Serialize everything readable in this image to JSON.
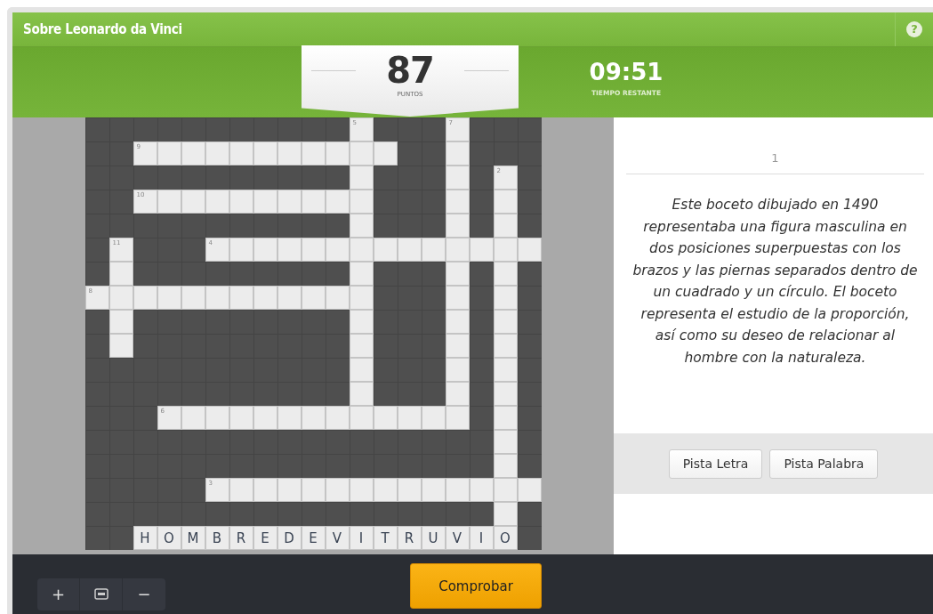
{
  "title": "Sobre Leonardo da Vinci",
  "help": "?",
  "score": {
    "value": "87",
    "label": "PUNTOS"
  },
  "timer": {
    "value": "09:51",
    "label": "TIEMPO RESTANTE"
  },
  "grid": [
    [
      {
        "kind": "block"
      },
      {
        "kind": "block"
      },
      {
        "kind": "block"
      },
      {
        "kind": "block"
      },
      {
        "kind": "block"
      },
      {
        "kind": "block"
      },
      {
        "kind": "block"
      },
      {
        "kind": "block"
      },
      {
        "kind": "block"
      },
      {
        "kind": "block"
      },
      {
        "kind": "block"
      },
      {
        "kind": "empty",
        "number": "5"
      },
      {
        "kind": "block"
      },
      {
        "kind": "block"
      },
      {
        "kind": "block"
      },
      {
        "kind": "empty",
        "number": "7"
      },
      {
        "kind": "block"
      },
      {
        "kind": "block"
      },
      {
        "kind": "block"
      }
    ],
    [
      {
        "kind": "block"
      },
      {
        "kind": "block"
      },
      {
        "kind": "empty",
        "number": "9"
      },
      {
        "kind": "empty"
      },
      {
        "kind": "empty"
      },
      {
        "kind": "empty"
      },
      {
        "kind": "empty"
      },
      {
        "kind": "empty"
      },
      {
        "kind": "empty"
      },
      {
        "kind": "empty"
      },
      {
        "kind": "empty"
      },
      {
        "kind": "empty"
      },
      {
        "kind": "empty"
      },
      {
        "kind": "block"
      },
      {
        "kind": "block"
      },
      {
        "kind": "empty"
      },
      {
        "kind": "block"
      },
      {
        "kind": "block"
      },
      {
        "kind": "block"
      }
    ],
    [
      {
        "kind": "block"
      },
      {
        "kind": "block"
      },
      {
        "kind": "block"
      },
      {
        "kind": "block"
      },
      {
        "kind": "block"
      },
      {
        "kind": "block"
      },
      {
        "kind": "block"
      },
      {
        "kind": "block"
      },
      {
        "kind": "block"
      },
      {
        "kind": "block"
      },
      {
        "kind": "block"
      },
      {
        "kind": "empty"
      },
      {
        "kind": "block"
      },
      {
        "kind": "block"
      },
      {
        "kind": "block"
      },
      {
        "kind": "empty"
      },
      {
        "kind": "block"
      },
      {
        "kind": "empty",
        "number": "2"
      },
      {
        "kind": "block"
      }
    ],
    [
      {
        "kind": "block"
      },
      {
        "kind": "block"
      },
      {
        "kind": "empty",
        "number": "10"
      },
      {
        "kind": "empty"
      },
      {
        "kind": "empty"
      },
      {
        "kind": "empty"
      },
      {
        "kind": "empty"
      },
      {
        "kind": "empty"
      },
      {
        "kind": "empty"
      },
      {
        "kind": "empty"
      },
      {
        "kind": "empty"
      },
      {
        "kind": "empty"
      },
      {
        "kind": "block"
      },
      {
        "kind": "block"
      },
      {
        "kind": "block"
      },
      {
        "kind": "empty"
      },
      {
        "kind": "block"
      },
      {
        "kind": "empty"
      },
      {
        "kind": "block"
      }
    ],
    [
      {
        "kind": "block"
      },
      {
        "kind": "block"
      },
      {
        "kind": "block"
      },
      {
        "kind": "block"
      },
      {
        "kind": "block"
      },
      {
        "kind": "block"
      },
      {
        "kind": "block"
      },
      {
        "kind": "block"
      },
      {
        "kind": "block"
      },
      {
        "kind": "block"
      },
      {
        "kind": "block"
      },
      {
        "kind": "empty"
      },
      {
        "kind": "block"
      },
      {
        "kind": "block"
      },
      {
        "kind": "block"
      },
      {
        "kind": "empty"
      },
      {
        "kind": "block"
      },
      {
        "kind": "empty"
      },
      {
        "kind": "block"
      }
    ],
    [
      {
        "kind": "block"
      },
      {
        "kind": "empty",
        "number": "11"
      },
      {
        "kind": "block"
      },
      {
        "kind": "block"
      },
      {
        "kind": "block"
      },
      {
        "kind": "empty",
        "number": "4"
      },
      {
        "kind": "empty"
      },
      {
        "kind": "empty"
      },
      {
        "kind": "empty"
      },
      {
        "kind": "empty"
      },
      {
        "kind": "empty"
      },
      {
        "kind": "empty"
      },
      {
        "kind": "empty"
      },
      {
        "kind": "empty"
      },
      {
        "kind": "empty"
      },
      {
        "kind": "empty"
      },
      {
        "kind": "empty"
      },
      {
        "kind": "empty"
      },
      {
        "kind": "empty"
      }
    ],
    [
      {
        "kind": "block"
      },
      {
        "kind": "empty"
      },
      {
        "kind": "block"
      },
      {
        "kind": "block"
      },
      {
        "kind": "block"
      },
      {
        "kind": "block"
      },
      {
        "kind": "block"
      },
      {
        "kind": "block"
      },
      {
        "kind": "block"
      },
      {
        "kind": "block"
      },
      {
        "kind": "block"
      },
      {
        "kind": "empty"
      },
      {
        "kind": "block"
      },
      {
        "kind": "block"
      },
      {
        "kind": "block"
      },
      {
        "kind": "empty"
      },
      {
        "kind": "block"
      },
      {
        "kind": "empty"
      },
      {
        "kind": "block"
      }
    ],
    [
      {
        "kind": "empty",
        "number": "8"
      },
      {
        "kind": "empty"
      },
      {
        "kind": "empty"
      },
      {
        "kind": "empty"
      },
      {
        "kind": "empty"
      },
      {
        "kind": "empty"
      },
      {
        "kind": "empty"
      },
      {
        "kind": "empty"
      },
      {
        "kind": "empty"
      },
      {
        "kind": "empty"
      },
      {
        "kind": "empty"
      },
      {
        "kind": "empty"
      },
      {
        "kind": "block"
      },
      {
        "kind": "block"
      },
      {
        "kind": "block"
      },
      {
        "kind": "empty"
      },
      {
        "kind": "block"
      },
      {
        "kind": "empty"
      },
      {
        "kind": "block"
      }
    ],
    [
      {
        "kind": "block"
      },
      {
        "kind": "empty"
      },
      {
        "kind": "block"
      },
      {
        "kind": "block"
      },
      {
        "kind": "block"
      },
      {
        "kind": "block"
      },
      {
        "kind": "block"
      },
      {
        "kind": "block"
      },
      {
        "kind": "block"
      },
      {
        "kind": "block"
      },
      {
        "kind": "block"
      },
      {
        "kind": "empty"
      },
      {
        "kind": "block"
      },
      {
        "kind": "block"
      },
      {
        "kind": "block"
      },
      {
        "kind": "empty"
      },
      {
        "kind": "block"
      },
      {
        "kind": "empty"
      },
      {
        "kind": "block"
      }
    ],
    [
      {
        "kind": "block"
      },
      {
        "kind": "empty"
      },
      {
        "kind": "block"
      },
      {
        "kind": "block"
      },
      {
        "kind": "block"
      },
      {
        "kind": "block"
      },
      {
        "kind": "block"
      },
      {
        "kind": "block"
      },
      {
        "kind": "block"
      },
      {
        "kind": "block"
      },
      {
        "kind": "block"
      },
      {
        "kind": "empty"
      },
      {
        "kind": "block"
      },
      {
        "kind": "block"
      },
      {
        "kind": "block"
      },
      {
        "kind": "empty"
      },
      {
        "kind": "block"
      },
      {
        "kind": "empty"
      },
      {
        "kind": "block"
      }
    ],
    [
      {
        "kind": "block"
      },
      {
        "kind": "block"
      },
      {
        "kind": "block"
      },
      {
        "kind": "block"
      },
      {
        "kind": "block"
      },
      {
        "kind": "block"
      },
      {
        "kind": "block"
      },
      {
        "kind": "block"
      },
      {
        "kind": "block"
      },
      {
        "kind": "block"
      },
      {
        "kind": "block"
      },
      {
        "kind": "empty"
      },
      {
        "kind": "block"
      },
      {
        "kind": "block"
      },
      {
        "kind": "block"
      },
      {
        "kind": "empty"
      },
      {
        "kind": "block"
      },
      {
        "kind": "empty"
      },
      {
        "kind": "block"
      }
    ],
    [
      {
        "kind": "block"
      },
      {
        "kind": "block"
      },
      {
        "kind": "block"
      },
      {
        "kind": "block"
      },
      {
        "kind": "block"
      },
      {
        "kind": "block"
      },
      {
        "kind": "block"
      },
      {
        "kind": "block"
      },
      {
        "kind": "block"
      },
      {
        "kind": "block"
      },
      {
        "kind": "block"
      },
      {
        "kind": "empty"
      },
      {
        "kind": "block"
      },
      {
        "kind": "block"
      },
      {
        "kind": "block"
      },
      {
        "kind": "empty"
      },
      {
        "kind": "block"
      },
      {
        "kind": "empty"
      },
      {
        "kind": "block"
      }
    ],
    [
      {
        "kind": "block"
      },
      {
        "kind": "block"
      },
      {
        "kind": "block"
      },
      {
        "kind": "empty",
        "number": "6"
      },
      {
        "kind": "empty"
      },
      {
        "kind": "empty"
      },
      {
        "kind": "empty"
      },
      {
        "kind": "empty"
      },
      {
        "kind": "empty"
      },
      {
        "kind": "empty"
      },
      {
        "kind": "empty"
      },
      {
        "kind": "empty"
      },
      {
        "kind": "empty"
      },
      {
        "kind": "empty"
      },
      {
        "kind": "empty"
      },
      {
        "kind": "empty"
      },
      {
        "kind": "block"
      },
      {
        "kind": "empty"
      },
      {
        "kind": "block"
      }
    ],
    [
      {
        "kind": "block"
      },
      {
        "kind": "block"
      },
      {
        "kind": "block"
      },
      {
        "kind": "block"
      },
      {
        "kind": "block"
      },
      {
        "kind": "block"
      },
      {
        "kind": "block"
      },
      {
        "kind": "block"
      },
      {
        "kind": "block"
      },
      {
        "kind": "block"
      },
      {
        "kind": "block"
      },
      {
        "kind": "block"
      },
      {
        "kind": "block"
      },
      {
        "kind": "block"
      },
      {
        "kind": "block"
      },
      {
        "kind": "block"
      },
      {
        "kind": "block"
      },
      {
        "kind": "empty"
      },
      {
        "kind": "block"
      }
    ],
    [
      {
        "kind": "block"
      },
      {
        "kind": "block"
      },
      {
        "kind": "block"
      },
      {
        "kind": "block"
      },
      {
        "kind": "block"
      },
      {
        "kind": "block"
      },
      {
        "kind": "block"
      },
      {
        "kind": "block"
      },
      {
        "kind": "block"
      },
      {
        "kind": "block"
      },
      {
        "kind": "block"
      },
      {
        "kind": "block"
      },
      {
        "kind": "block"
      },
      {
        "kind": "block"
      },
      {
        "kind": "block"
      },
      {
        "kind": "block"
      },
      {
        "kind": "block"
      },
      {
        "kind": "empty"
      },
      {
        "kind": "block"
      }
    ],
    [
      {
        "kind": "block"
      },
      {
        "kind": "block"
      },
      {
        "kind": "block"
      },
      {
        "kind": "block"
      },
      {
        "kind": "block"
      },
      {
        "kind": "empty",
        "number": "3"
      },
      {
        "kind": "empty"
      },
      {
        "kind": "empty"
      },
      {
        "kind": "empty"
      },
      {
        "kind": "empty"
      },
      {
        "kind": "empty"
      },
      {
        "kind": "empty"
      },
      {
        "kind": "empty"
      },
      {
        "kind": "empty"
      },
      {
        "kind": "empty"
      },
      {
        "kind": "empty"
      },
      {
        "kind": "empty"
      },
      {
        "kind": "empty"
      },
      {
        "kind": "empty"
      }
    ],
    [
      {
        "kind": "block"
      },
      {
        "kind": "block"
      },
      {
        "kind": "block"
      },
      {
        "kind": "block"
      },
      {
        "kind": "block"
      },
      {
        "kind": "block"
      },
      {
        "kind": "block"
      },
      {
        "kind": "block"
      },
      {
        "kind": "block"
      },
      {
        "kind": "block"
      },
      {
        "kind": "block"
      },
      {
        "kind": "block"
      },
      {
        "kind": "block"
      },
      {
        "kind": "block"
      },
      {
        "kind": "block"
      },
      {
        "kind": "block"
      },
      {
        "kind": "block"
      },
      {
        "kind": "empty"
      },
      {
        "kind": "block"
      }
    ],
    [
      {
        "kind": "block"
      },
      {
        "kind": "block"
      },
      {
        "kind": "letter",
        "letter": "H"
      },
      {
        "kind": "letter",
        "letter": "O"
      },
      {
        "kind": "letter",
        "letter": "M"
      },
      {
        "kind": "letter",
        "letter": "B"
      },
      {
        "kind": "letter",
        "letter": "R"
      },
      {
        "kind": "letter",
        "letter": "E"
      },
      {
        "kind": "letter",
        "letter": "D"
      },
      {
        "kind": "letter",
        "letter": "E"
      },
      {
        "kind": "letter",
        "letter": "V"
      },
      {
        "kind": "letter",
        "letter": "I"
      },
      {
        "kind": "letter",
        "letter": "T"
      },
      {
        "kind": "letter",
        "letter": "R"
      },
      {
        "kind": "letter",
        "letter": "U"
      },
      {
        "kind": "letter",
        "letter": "V"
      },
      {
        "kind": "letter",
        "letter": "I"
      },
      {
        "kind": "letter",
        "letter": "O"
      },
      {
        "kind": "block"
      }
    ]
  ],
  "clue": {
    "number": "1",
    "text": "Este boceto dibujado en 1490 representaba una figura masculina en dos posiciones superpuestas con los brazos y las piernas separados dentro de un cuadrado y un círculo. El boceto representa el estudio de la proporción, así como su deseo de relacionar al hombre con la naturaleza."
  },
  "hint_buttons": [
    "Pista Letra",
    "Pista Palabra"
  ],
  "zoom": {
    "zoom_in": "+",
    "zoom_out": "−"
  },
  "check_button": "Comprobar"
}
